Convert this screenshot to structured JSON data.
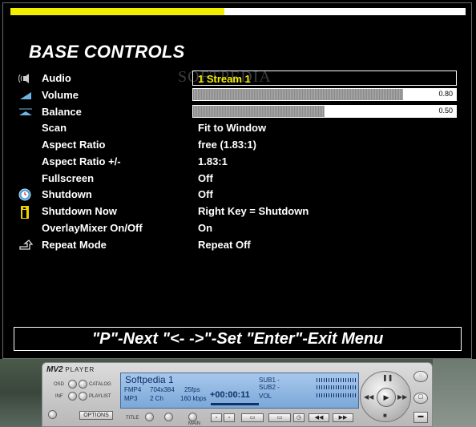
{
  "menu": {
    "progress": 0.47,
    "title": "BASE CONTROLS",
    "watermark": "SOFTPEDIA",
    "items": [
      {
        "label": "Audio",
        "value": "1 Stream 1",
        "icon": "speaker-icon"
      },
      {
        "label": "Volume",
        "value": "0.80",
        "icon": "volume-icon",
        "level": 0.8
      },
      {
        "label": "Balance",
        "value": "0.50",
        "icon": "balance-icon",
        "level": 0.5
      },
      {
        "label": "Scan",
        "value": "Fit to Window"
      },
      {
        "label": "Aspect Ratio",
        "value": "free (1.83:1)"
      },
      {
        "label": "Aspect Ratio +/-",
        "value": "1.83:1"
      },
      {
        "label": "Fullscreen",
        "value": "Off"
      },
      {
        "label": "Shutdown",
        "value": "Off",
        "icon": "clock-icon"
      },
      {
        "label": "Shutdown Now",
        "value": "Right Key = Shutdown",
        "icon": "power-icon"
      },
      {
        "label": "OverlayMixer On/Off",
        "value": "On"
      },
      {
        "label": "Repeat Mode",
        "value": "Repeat Off",
        "icon": "repeat-icon"
      }
    ],
    "footer": "\"P\"-Next  \"<- ->\"-Set  \"Enter\"-Exit Menu",
    "accent_color": "#f2ee00"
  },
  "player": {
    "logo": "MV2",
    "logo_sub": "PLAYER",
    "buttons": {
      "osd": "OSD",
      "catalog": "CATALOG",
      "inf": "INF",
      "playlist": "PLAYLIST",
      "options": "OPTIONS",
      "title": "TITLE",
      "main": "MAIN"
    },
    "lcd": {
      "title": "Softpedia 1",
      "format1": "FMP4",
      "res": "704x384",
      "fps": "25fps",
      "format2": "MP3",
      "channels": "2 Ch",
      "bitrate": "160 kbps",
      "time": "+00:00:11",
      "vol_label": "VOL",
      "sub1": "SUB1 -",
      "sub2": "SUB2 -"
    }
  }
}
